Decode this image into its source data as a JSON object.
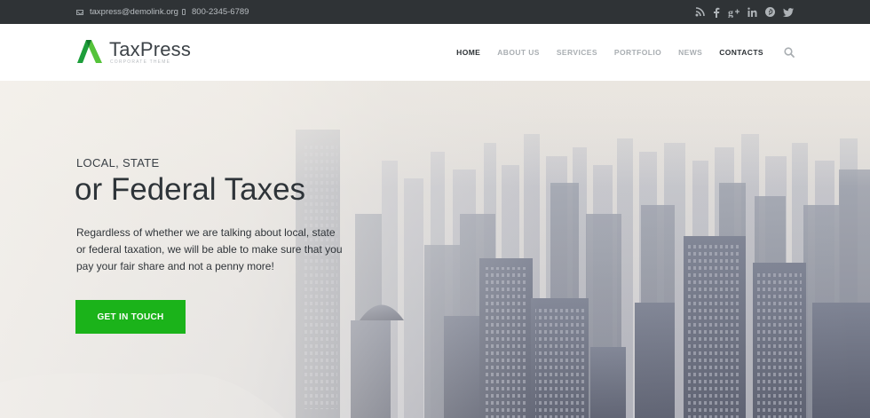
{
  "topbar": {
    "email": "taxpress@demolink.org",
    "phone": "800-2345-6789",
    "email_icon": "envelope-icon",
    "phone_icon": "mobile-phone-icon",
    "social_icons": [
      "rss-icon",
      "facebook-icon",
      "google-plus-icon",
      "linkedin-icon",
      "pinterest-icon",
      "twitter-icon"
    ]
  },
  "logo": {
    "name": "TaxPress",
    "tagline": "CORPORATE THEME",
    "mark_icon": "green-a-logo-icon"
  },
  "nav": {
    "items": [
      {
        "label": "HOME",
        "active": true
      },
      {
        "label": "ABOUT US",
        "active": false
      },
      {
        "label": "SERVICES",
        "active": false
      },
      {
        "label": "PORTFOLIO",
        "active": false
      },
      {
        "label": "NEWS",
        "active": false
      },
      {
        "label": "CONTACTS",
        "active": false
      }
    ],
    "search_icon": "search-icon"
  },
  "hero": {
    "kicker": "LOCAL, STATE",
    "headline": "or Federal Taxes",
    "paragraph": "Regardless of whether we are talking about local, state or federal taxation, we will be able to make sure that you pay your fair share and not a penny more!",
    "cta_label": "GET IN TOUCH"
  },
  "colors": {
    "topbar_bg": "#2f3336",
    "accent_green": "#1bb31a",
    "text_dark": "#2e3439",
    "nav_muted": "#a9aeb2"
  }
}
